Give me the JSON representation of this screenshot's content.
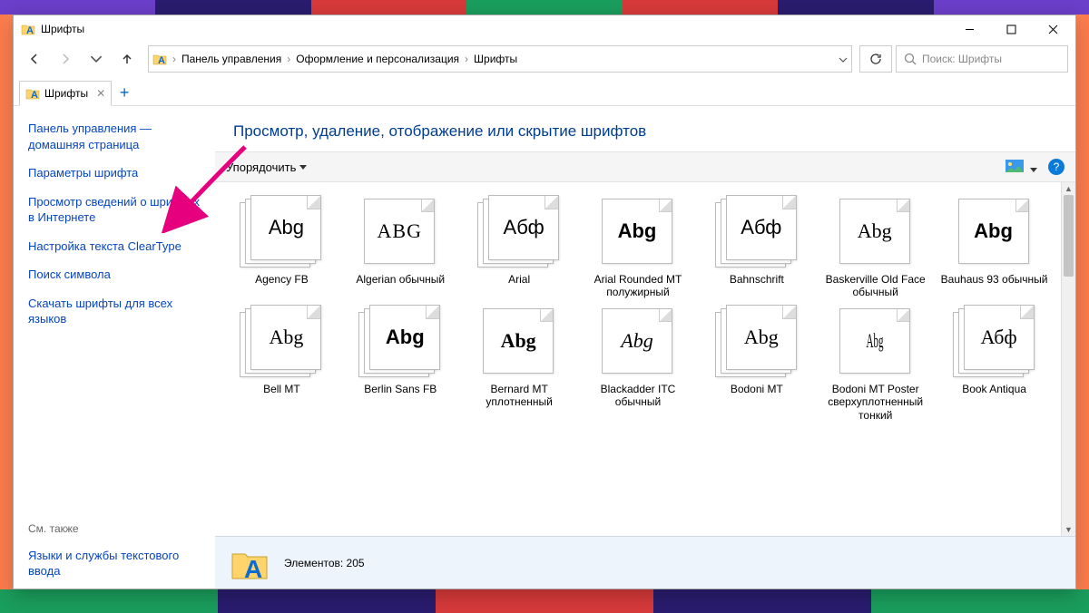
{
  "window": {
    "title": "Шрифты"
  },
  "breadcrumb": {
    "seg1": "Панель управления",
    "seg2": "Оформление и персонализация",
    "seg3": "Шрифты"
  },
  "search": {
    "placeholder": "Поиск: Шрифты"
  },
  "tab": {
    "label": "Шрифты"
  },
  "sidebar": {
    "home": "Панель управления — домашняя страница",
    "links": [
      "Параметры шрифта",
      "Просмотр сведений о шрифтах в Интернете",
      "Настройка текста ClearType",
      "Поиск символа",
      "Скачать шрифты для всех языков"
    ],
    "also_label": "См. также",
    "also_link": "Языки и службы текстового ввода"
  },
  "headline": "Просмотр, удаление, отображение или скрытие шрифтов",
  "toolbar": {
    "organize": "Упорядочить"
  },
  "fonts": [
    {
      "sample": "Abg",
      "label": "Agency FB",
      "style": "font-family:'Agency FB',sans-serif;font-stretch:condensed;",
      "stack": true
    },
    {
      "sample": "ABG",
      "label": "Algerian обычный",
      "style": "font-family:serif;font-variant:small-caps;letter-spacing:1px;",
      "stack": false
    },
    {
      "sample": "Абф",
      "label": "Arial",
      "style": "font-family:Arial,sans-serif;",
      "stack": true
    },
    {
      "sample": "Abg",
      "label": "Arial Rounded MT полужирный",
      "style": "font-family:'Arial Rounded MT Bold',Arial,sans-serif;font-weight:900;",
      "stack": false
    },
    {
      "sample": "Абф",
      "label": "Bahnschrift",
      "style": "font-family:Bahnschrift,Arial,sans-serif;",
      "stack": true
    },
    {
      "sample": "Abg",
      "label": "Baskerville Old Face обычный",
      "style": "font-family:'Baskerville Old Face',Georgia,serif;",
      "stack": false
    },
    {
      "sample": "Abg",
      "label": "Bauhaus 93 обычный",
      "style": "font-family:'Bauhaus 93',sans-serif;font-weight:900;",
      "stack": false
    },
    {
      "sample": "Abg",
      "label": "Bell MT",
      "style": "font-family:'Bell MT',Georgia,serif;",
      "stack": true
    },
    {
      "sample": "Abg",
      "label": "Berlin Sans FB",
      "style": "font-family:'Berlin Sans FB',Arial,sans-serif;font-weight:700;",
      "stack": true
    },
    {
      "sample": "Abg",
      "label": "Bernard MT уплотненный",
      "style": "font-family:'Bernard MT Condensed',serif;font-weight:900;font-stretch:condensed;",
      "stack": false
    },
    {
      "sample": "Abg",
      "label": "Blackadder ITC обычный",
      "style": "font-family:'Blackadder ITC',cursive;font-style:italic;",
      "stack": false
    },
    {
      "sample": "Abg",
      "label": "Bodoni MT",
      "style": "font-family:'Bodoni MT',Didot,serif;",
      "stack": true
    },
    {
      "sample": "Abg",
      "label": "Bodoni MT Poster сверхуплотненный тонкий",
      "style": "font-family:'Bodoni MT',Didot,serif;font-stretch:ultra-condensed;transform:scaleX(.5);",
      "stack": false
    },
    {
      "sample": "Абф",
      "label": "Book Antiqua",
      "style": "font-family:'Book Antiqua',Palatino,serif;",
      "stack": true
    }
  ],
  "status": {
    "count_label": "Элементов:",
    "count": "205"
  }
}
